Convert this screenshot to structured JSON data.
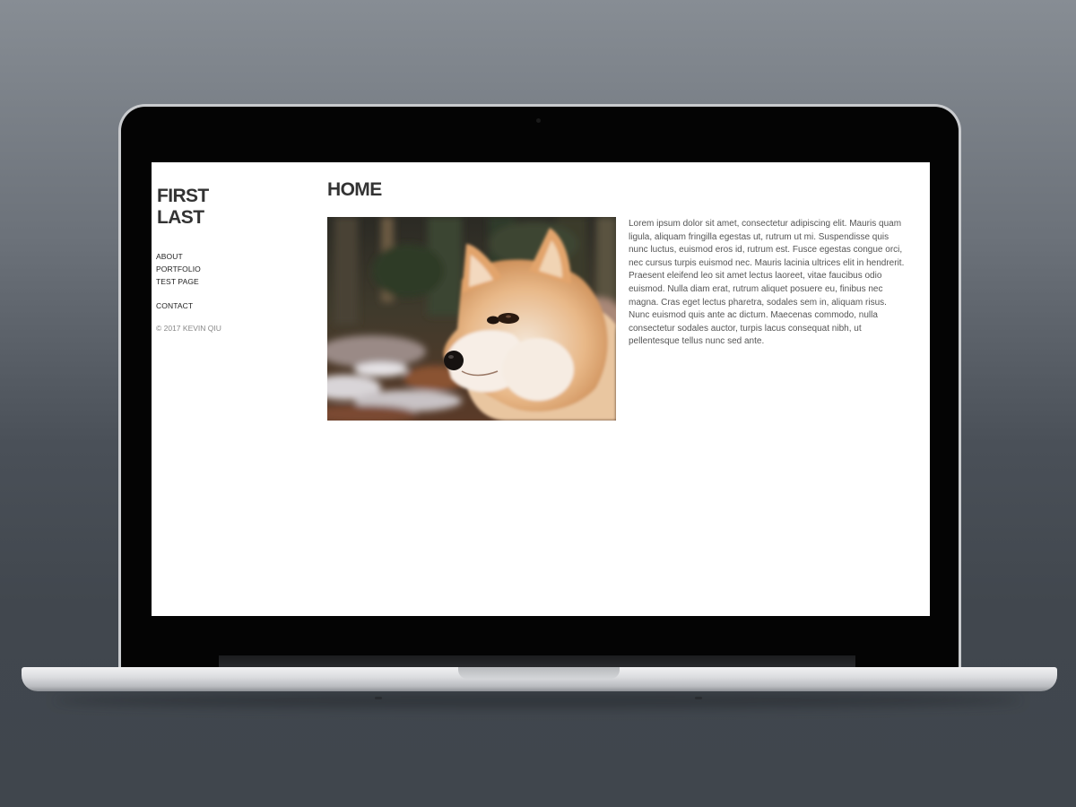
{
  "site": {
    "logo_line1": "FIRST",
    "logo_line2": "LAST",
    "nav": [
      {
        "label": "ABOUT"
      },
      {
        "label": "PORTFOLIO"
      },
      {
        "label": "TEST PAGE"
      },
      {
        "label": "CONTACT"
      }
    ],
    "copyright": "© 2017 KEVIN QIU"
  },
  "main": {
    "title": "HOME",
    "body": "Lorem ipsum dolor sit amet, consectetur adipiscing elit. Mauris quam ligula, aliquam fringilla egestas ut, rutrum ut mi. Suspendisse quis nunc luctus, euismod eros id, rutrum est. Fusce egestas congue orci, nec cursus turpis euismod nec. Mauris lacinia ultrices elit in hendrerit. Praesent eleifend leo sit amet lectus laoreet, vitae faucibus odio euismod. Nulla diam erat, rutrum aliquet posuere eu, finibus nec magna. Cras eget lectus pharetra, sodales sem in, aliquam risus. Nunc euismod quis ante ac dictum. Maecenas commodo, nulla consectetur sodales auctor, turpis lacus consequat nibh, ut pellentesque tellus nunc sed ante.",
    "image": "shiba-inu-dog-photo"
  },
  "colors": {
    "background_top": "#878d94",
    "background_bottom": "#40464d",
    "bezel": "#040404",
    "screen": "#ffffff",
    "heading": "#333333",
    "body_text": "#555555",
    "muted": "#888888"
  }
}
